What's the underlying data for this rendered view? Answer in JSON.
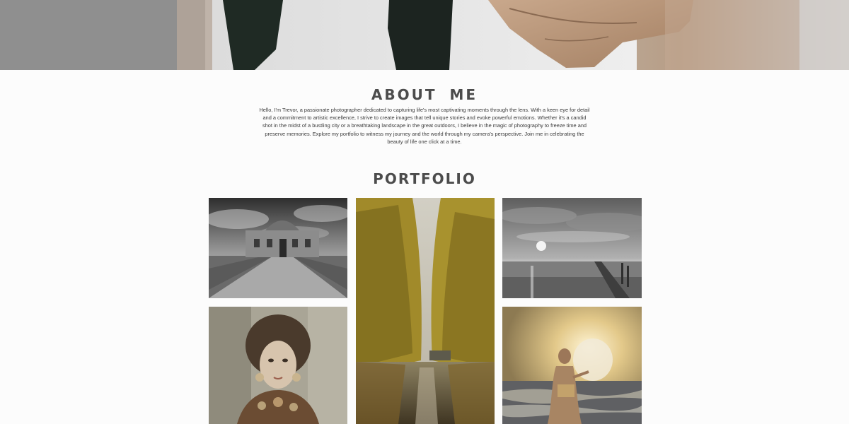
{
  "about": {
    "title": "ABOUT  ME",
    "body": "Hello, I'm Trevor, a passionate photographer dedicated to capturing life's most captivating moments through the lens. With a keen eye for detail and a commitment to artistic excellence, I strive to create images that tell unique stories and evoke powerful emotions. Whether it's a candid shot in the midst of a bustling city or a breathtaking landscape in the great outdoors, I believe in the magic of photography to freeze time and preserve memories. Explore my portfolio to witness my journey and the world through my camera's perspective. Join me in celebrating the beauty of life one click at a time."
  },
  "portfolio": {
    "title": "PORTFOLIO"
  }
}
